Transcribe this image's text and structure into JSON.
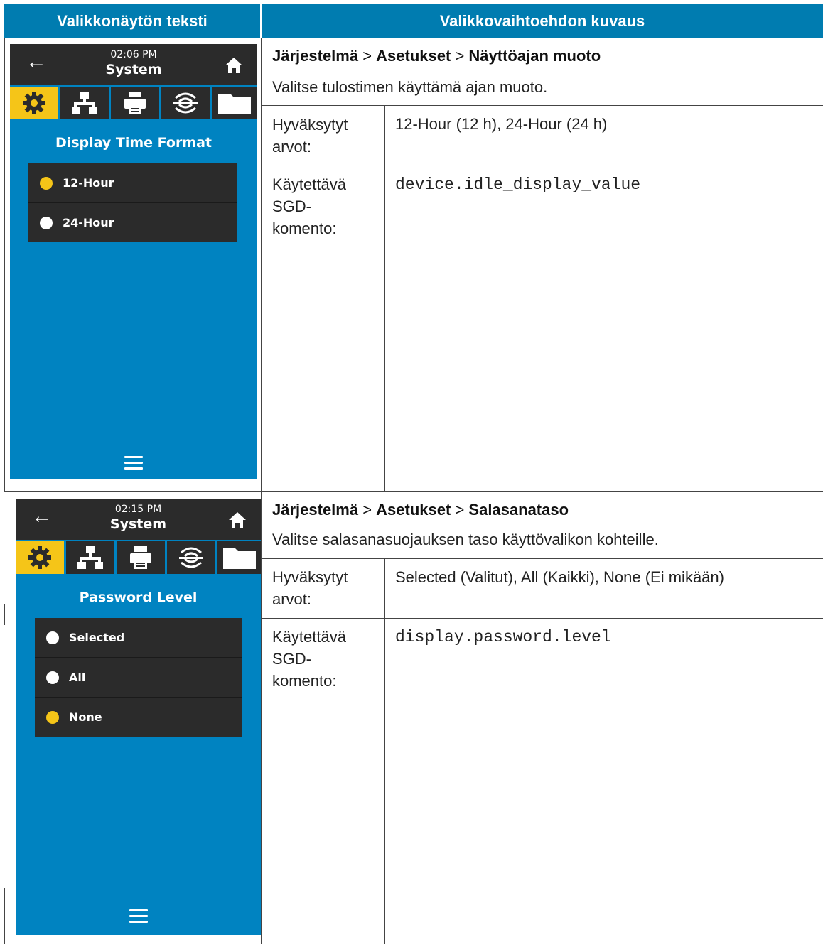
{
  "table": {
    "header_left": "Valikkonäytön teksti",
    "header_right": "Valikkovaihtoehdon kuvaus"
  },
  "rows": [
    {
      "screen": {
        "time": "02:06 PM",
        "title": "System",
        "heading": "Display Time Format",
        "options": [
          {
            "label": "12-Hour",
            "selected": true
          },
          {
            "label": "24-Hour",
            "selected": false
          }
        ]
      },
      "path": {
        "a": "Järjestelmä",
        "sep1": " > ",
        "b": "Asetukset",
        "sep2": " > ",
        "c": "Näyttöajan muoto"
      },
      "description": "Valitse tulostimen käyttämä ajan muoto.",
      "accepted_label": "Hyväksytyt arvot:",
      "accepted_value": "12-Hour (12 h), 24-Hour (24 h)",
      "sgd_label": "Käytettävä SGD-komento:",
      "sgd_value": "device.idle_display_value"
    },
    {
      "screen": {
        "time": "02:15 PM",
        "title": "System",
        "heading": "Password Level",
        "options": [
          {
            "label": "Selected",
            "selected": false
          },
          {
            "label": "All",
            "selected": false
          },
          {
            "label": "None",
            "selected": true
          }
        ]
      },
      "path": {
        "a": "Järjestelmä",
        "sep1": " > ",
        "b": "Asetukset",
        "sep2": " > ",
        "c": "Salasanataso"
      },
      "description": "Valitse salasanasuojauksen taso käyttövalikon kohteille.",
      "accepted_label": "Hyväksytyt arvot:",
      "accepted_value": "Selected (Valitut), All (Kaikki), None (Ei mikään)",
      "sgd_label": "Käytettävä SGD-komento:",
      "sgd_value": "display.password.level"
    }
  ],
  "colors": {
    "header": "#007cb0",
    "screen_bg": "#0083c1",
    "bar": "#2b2b2b",
    "accent": "#f5c518"
  },
  "icons": [
    "back-arrow-icon",
    "home-icon",
    "gear-icon",
    "network-icon",
    "printer-icon",
    "connectivity-icon",
    "folder-icon",
    "menu-icon"
  ]
}
